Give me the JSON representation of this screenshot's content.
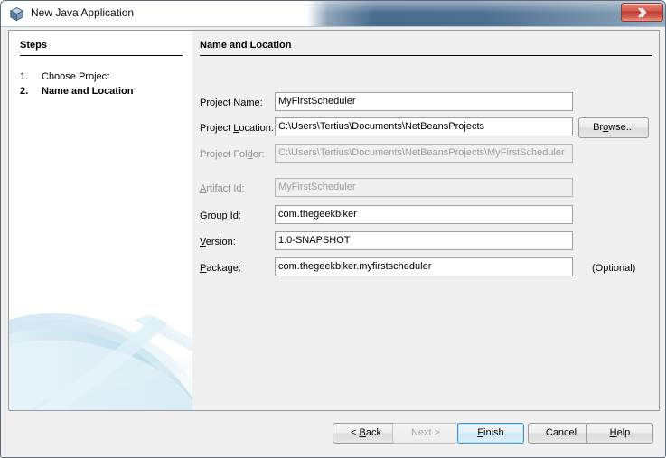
{
  "window": {
    "title": "New Java Application",
    "icon": "java-cube-icon",
    "close_label": "x",
    "accent_color": "#4a6c8f",
    "close_color": "#bc3a2c"
  },
  "steps_panel": {
    "heading": "Steps",
    "items": [
      {
        "number": "1.",
        "label": "Choose Project",
        "current": false
      },
      {
        "number": "2.",
        "label": "Name and Location",
        "current": true
      }
    ]
  },
  "content": {
    "heading": "Name and Location",
    "fields": [
      {
        "label_before": "Project ",
        "label_mnemonic": "N",
        "label_after": "ame:",
        "value": "MyFirstScheduler",
        "disabled": false
      },
      {
        "label_before": "Project ",
        "label_mnemonic": "L",
        "label_after": "ocation:",
        "value": "C:\\Users\\Tertius\\Documents\\NetBeansProjects",
        "disabled": false
      },
      {
        "label_before": "Project Fol",
        "label_mnemonic": "d",
        "label_after": "er:",
        "value": "C:\\Users\\Tertius\\Documents\\NetBeansProjects\\MyFirstScheduler",
        "disabled": true
      },
      {
        "label_before": "",
        "label_mnemonic": "A",
        "label_after": "rtifact Id:",
        "value": "MyFirstScheduler",
        "disabled": true
      },
      {
        "label_before": "",
        "label_mnemonic": "G",
        "label_after": "roup Id:",
        "value": "com.thegeekbiker",
        "disabled": false
      },
      {
        "label_before": "",
        "label_mnemonic": "V",
        "label_after": "ersion:",
        "value": "1.0-SNAPSHOT",
        "disabled": false
      },
      {
        "label_before": "",
        "label_mnemonic": "P",
        "label_after": "ackage:",
        "value": "com.thegeekbiker.myfirstscheduler",
        "disabled": false
      }
    ],
    "browse_button": {
      "before": "Br",
      "mnemonic": "o",
      "after": "wse..."
    },
    "optional_note": "(Optional)"
  },
  "footer": {
    "buttons": [
      {
        "before": "< ",
        "mnemonic": "B",
        "after": "ack",
        "state": "normal"
      },
      {
        "before": "Next >",
        "mnemonic": "",
        "after": "",
        "state": "disabled"
      },
      {
        "before": "",
        "mnemonic": "F",
        "after": "inish",
        "state": "default"
      },
      {
        "before": "Cancel",
        "mnemonic": "",
        "after": "",
        "state": "normal"
      },
      {
        "before": "",
        "mnemonic": "H",
        "after": "elp",
        "state": "normal"
      }
    ]
  }
}
